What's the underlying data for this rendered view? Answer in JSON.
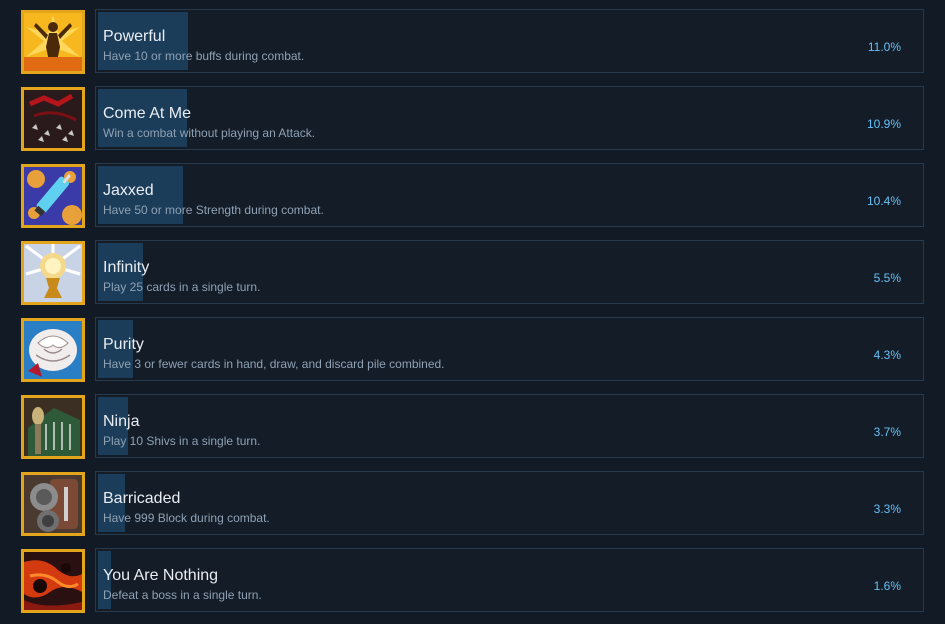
{
  "achievements": [
    {
      "name": "Powerful",
      "description": "Have 10 or more buffs during combat.",
      "percent": "11.0%",
      "fraction": 0.11,
      "icon": "powerful-icon"
    },
    {
      "name": "Come At Me",
      "description": "Win a combat without playing an Attack.",
      "percent": "10.9%",
      "fraction": 0.109,
      "icon": "come-at-me-icon"
    },
    {
      "name": "Jaxxed",
      "description": "Have 50 or more Strength during combat.",
      "percent": "10.4%",
      "fraction": 0.104,
      "icon": "jaxxed-icon"
    },
    {
      "name": "Infinity",
      "description": "Play 25 cards in a single turn.",
      "percent": "5.5%",
      "fraction": 0.055,
      "icon": "infinity-icon"
    },
    {
      "name": "Purity",
      "description": "Have 3 or fewer cards in hand, draw, and discard pile combined.",
      "percent": "4.3%",
      "fraction": 0.043,
      "icon": "purity-icon"
    },
    {
      "name": "Ninja",
      "description": "Play 10 Shivs in a single turn.",
      "percent": "3.7%",
      "fraction": 0.037,
      "icon": "ninja-icon"
    },
    {
      "name": "Barricaded",
      "description": "Have 999 Block during combat.",
      "percent": "3.3%",
      "fraction": 0.033,
      "icon": "barricaded-icon"
    },
    {
      "name": "You Are Nothing",
      "description": "Defeat a boss in a single turn.",
      "percent": "1.6%",
      "fraction": 0.016,
      "icon": "you-are-nothing-icon"
    }
  ],
  "colors": {
    "background": "#121a26",
    "bar_fill": "#1b3d5a",
    "percent_text": "#66c0f4",
    "icon_frame": "#e3a51c"
  }
}
